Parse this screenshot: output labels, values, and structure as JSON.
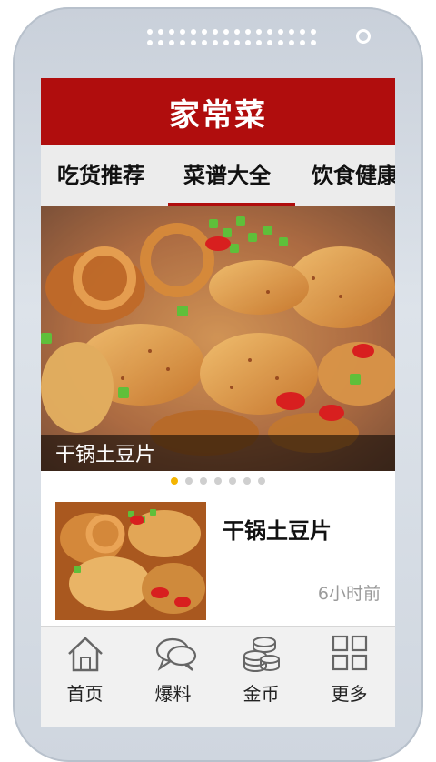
{
  "app": {
    "title": "家常菜"
  },
  "tabs": [
    {
      "label": "吃货推荐",
      "active": false
    },
    {
      "label": "菜谱大全",
      "active": true
    },
    {
      "label": "饮食健康",
      "active": false
    }
  ],
  "banner": {
    "caption": "干锅土豆片",
    "pager": {
      "count": 7,
      "active_index": 0
    }
  },
  "list": [
    {
      "title": "干锅土豆片",
      "time": "6小时前"
    }
  ],
  "bottom_nav": [
    {
      "label": "首页",
      "icon": "home-icon"
    },
    {
      "label": "爆料",
      "icon": "chat-bubble-icon"
    },
    {
      "label": "金币",
      "icon": "coins-icon"
    },
    {
      "label": "更多",
      "icon": "grid-icon"
    }
  ],
  "colors": {
    "accent": "#b00d0d",
    "pager_active": "#f4b400",
    "pager_inactive": "#cfcfcf"
  }
}
